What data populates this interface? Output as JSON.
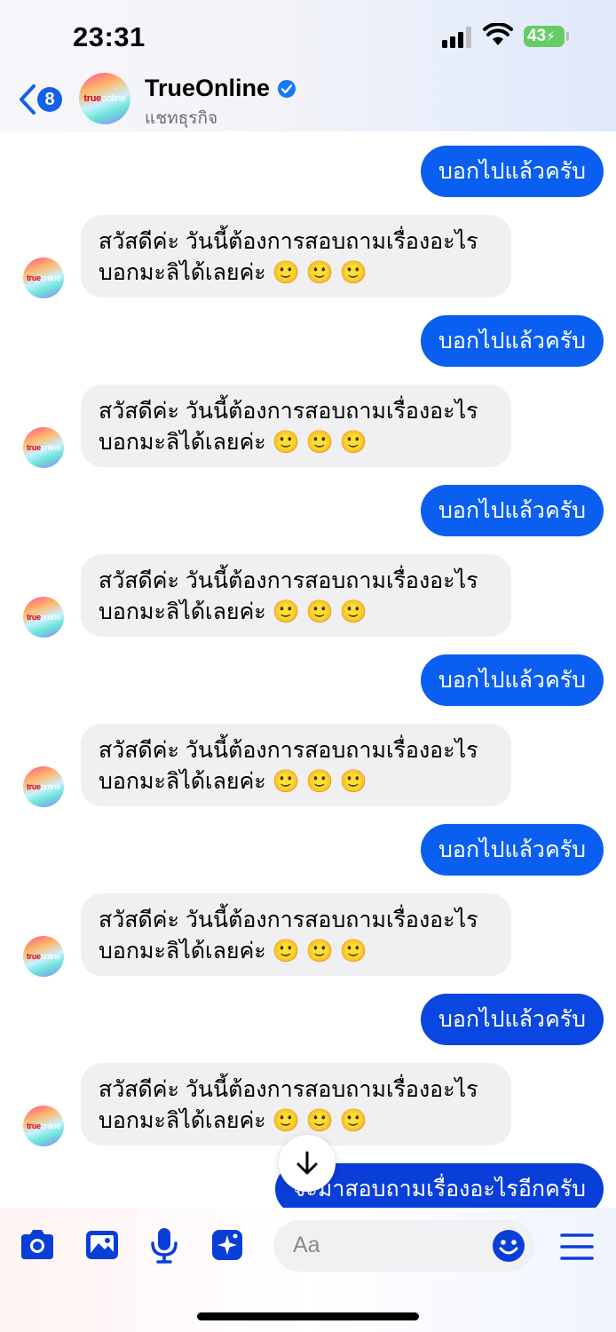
{
  "status_bar": {
    "time": "23:31",
    "battery": "43"
  },
  "header": {
    "back_count": "8",
    "title": "TrueOnline",
    "subtitle": "แชทธุรกิจ",
    "logo_text_1": "true",
    "logo_text_2": "online"
  },
  "messages": [
    {
      "direction": "out",
      "text": "บอกไปแล้วครับ"
    },
    {
      "direction": "in",
      "line1": "สวัสดีค่ะ วันนี้ต้องการสอบถามเรื่องอะไร",
      "line2": "บอกมะลิได้เลยค่ะ 🙂 🙂 🙂"
    },
    {
      "direction": "out",
      "text": "บอกไปแล้วครับ"
    },
    {
      "direction": "in",
      "line1": "สวัสดีค่ะ วันนี้ต้องการสอบถามเรื่องอะไร",
      "line2": "บอกมะลิได้เลยค่ะ 🙂 🙂 🙂"
    },
    {
      "direction": "out",
      "text": "บอกไปแล้วครับ"
    },
    {
      "direction": "in",
      "line1": "สวัสดีค่ะ วันนี้ต้องการสอบถามเรื่องอะไร",
      "line2": "บอกมะลิได้เลยค่ะ 🙂 🙂 🙂"
    },
    {
      "direction": "out",
      "text": "บอกไปแล้วครับ"
    },
    {
      "direction": "in",
      "line1": "สวัสดีค่ะ วันนี้ต้องการสอบถามเรื่องอะไร",
      "line2": "บอกมะลิได้เลยค่ะ 🙂 🙂 🙂"
    },
    {
      "direction": "out",
      "text": "บอกไปแล้วครับ"
    },
    {
      "direction": "in",
      "line1": "สวัสดีค่ะ วันนี้ต้องการสอบถามเรื่องอะไร",
      "line2": "บอกมะลิได้เลยค่ะ 🙂 🙂 🙂"
    },
    {
      "direction": "out",
      "text": "บอกไปแล้วครับ"
    },
    {
      "direction": "in",
      "line1": "สวัสดีค่ะ วันนี้ต้องการสอบถามเรื่องอะไร",
      "line2": "บอกมะลิได้เลยค่ะ 🙂 🙂 🙂"
    },
    {
      "direction": "out",
      "text": "จะมาสอบถามเรื่องอะไรอีกครับ"
    }
  ],
  "composer": {
    "placeholder": "Aa",
    "tools": [
      "camera-icon",
      "image-icon",
      "microphone-icon",
      "sticker-sparkle-icon"
    ],
    "emoji_icon": "smiley-icon",
    "menu_icon": "hamburger-menu-icon"
  },
  "colors": {
    "accent": "#0a5ff0",
    "incoming_bubble": "#f0f0f3"
  }
}
